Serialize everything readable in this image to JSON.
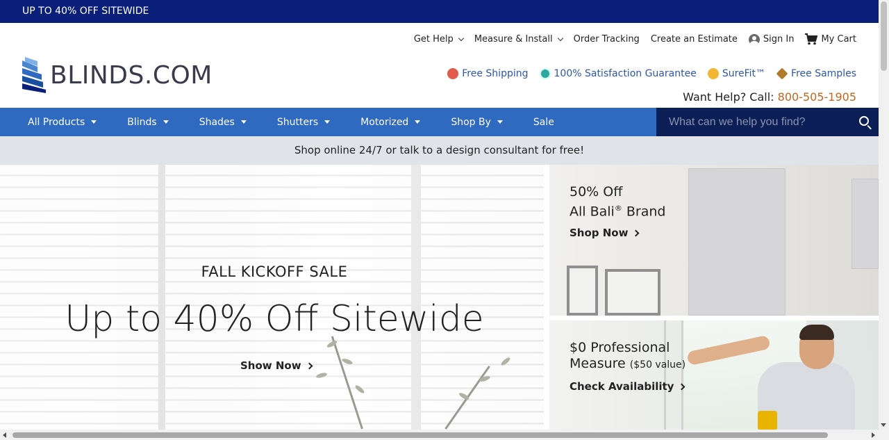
{
  "promo_bar": {
    "text": "UP TO 40% OFF SITEWIDE"
  },
  "utility_nav": {
    "get_help": "Get Help",
    "measure_install": "Measure & Install",
    "order_tracking": "Order Tracking",
    "create_estimate": "Create an Estimate",
    "sign_in": "Sign In",
    "my_cart": "My Cart"
  },
  "logo": {
    "text": "BLINDS.COM"
  },
  "benefits": {
    "free_shipping": "Free Shipping",
    "guarantee": "100% Satisfaction Guarantee",
    "surefit": "SureFit™",
    "free_samples": "Free Samples"
  },
  "phone": {
    "label": "Want Help? Call:",
    "number": "800-505-1905"
  },
  "main_nav": {
    "all_products": "All Products",
    "blinds": "Blinds",
    "shades": "Shades",
    "shutters": "Shutters",
    "motorized": "Motorized",
    "shop_by": "Shop By",
    "sale": "Sale"
  },
  "search": {
    "placeholder": "What can we help you find?"
  },
  "sub_banner": {
    "text": "Shop online 24/7 or talk to a design consultant for free!"
  },
  "hero": {
    "kicker": "FALL KICKOFF SALE",
    "title": "Up to 40% Off Sitewide",
    "cta": "Show Now"
  },
  "promo_bali": {
    "line1": "50% Off",
    "line2": "All Bali",
    "reg": "®",
    "line2_suffix": " Brand",
    "cta": "Shop Now"
  },
  "promo_measure": {
    "line1": "$0 Professional",
    "line2": "Measure",
    "value_note": "($50 value)",
    "cta": "Check Availability"
  },
  "colors": {
    "promo_bar": "#0a1f7a",
    "nav": "#2f6ac0",
    "search": "#0b1f56",
    "link": "#2e56a6",
    "phone": "#c5641a"
  }
}
